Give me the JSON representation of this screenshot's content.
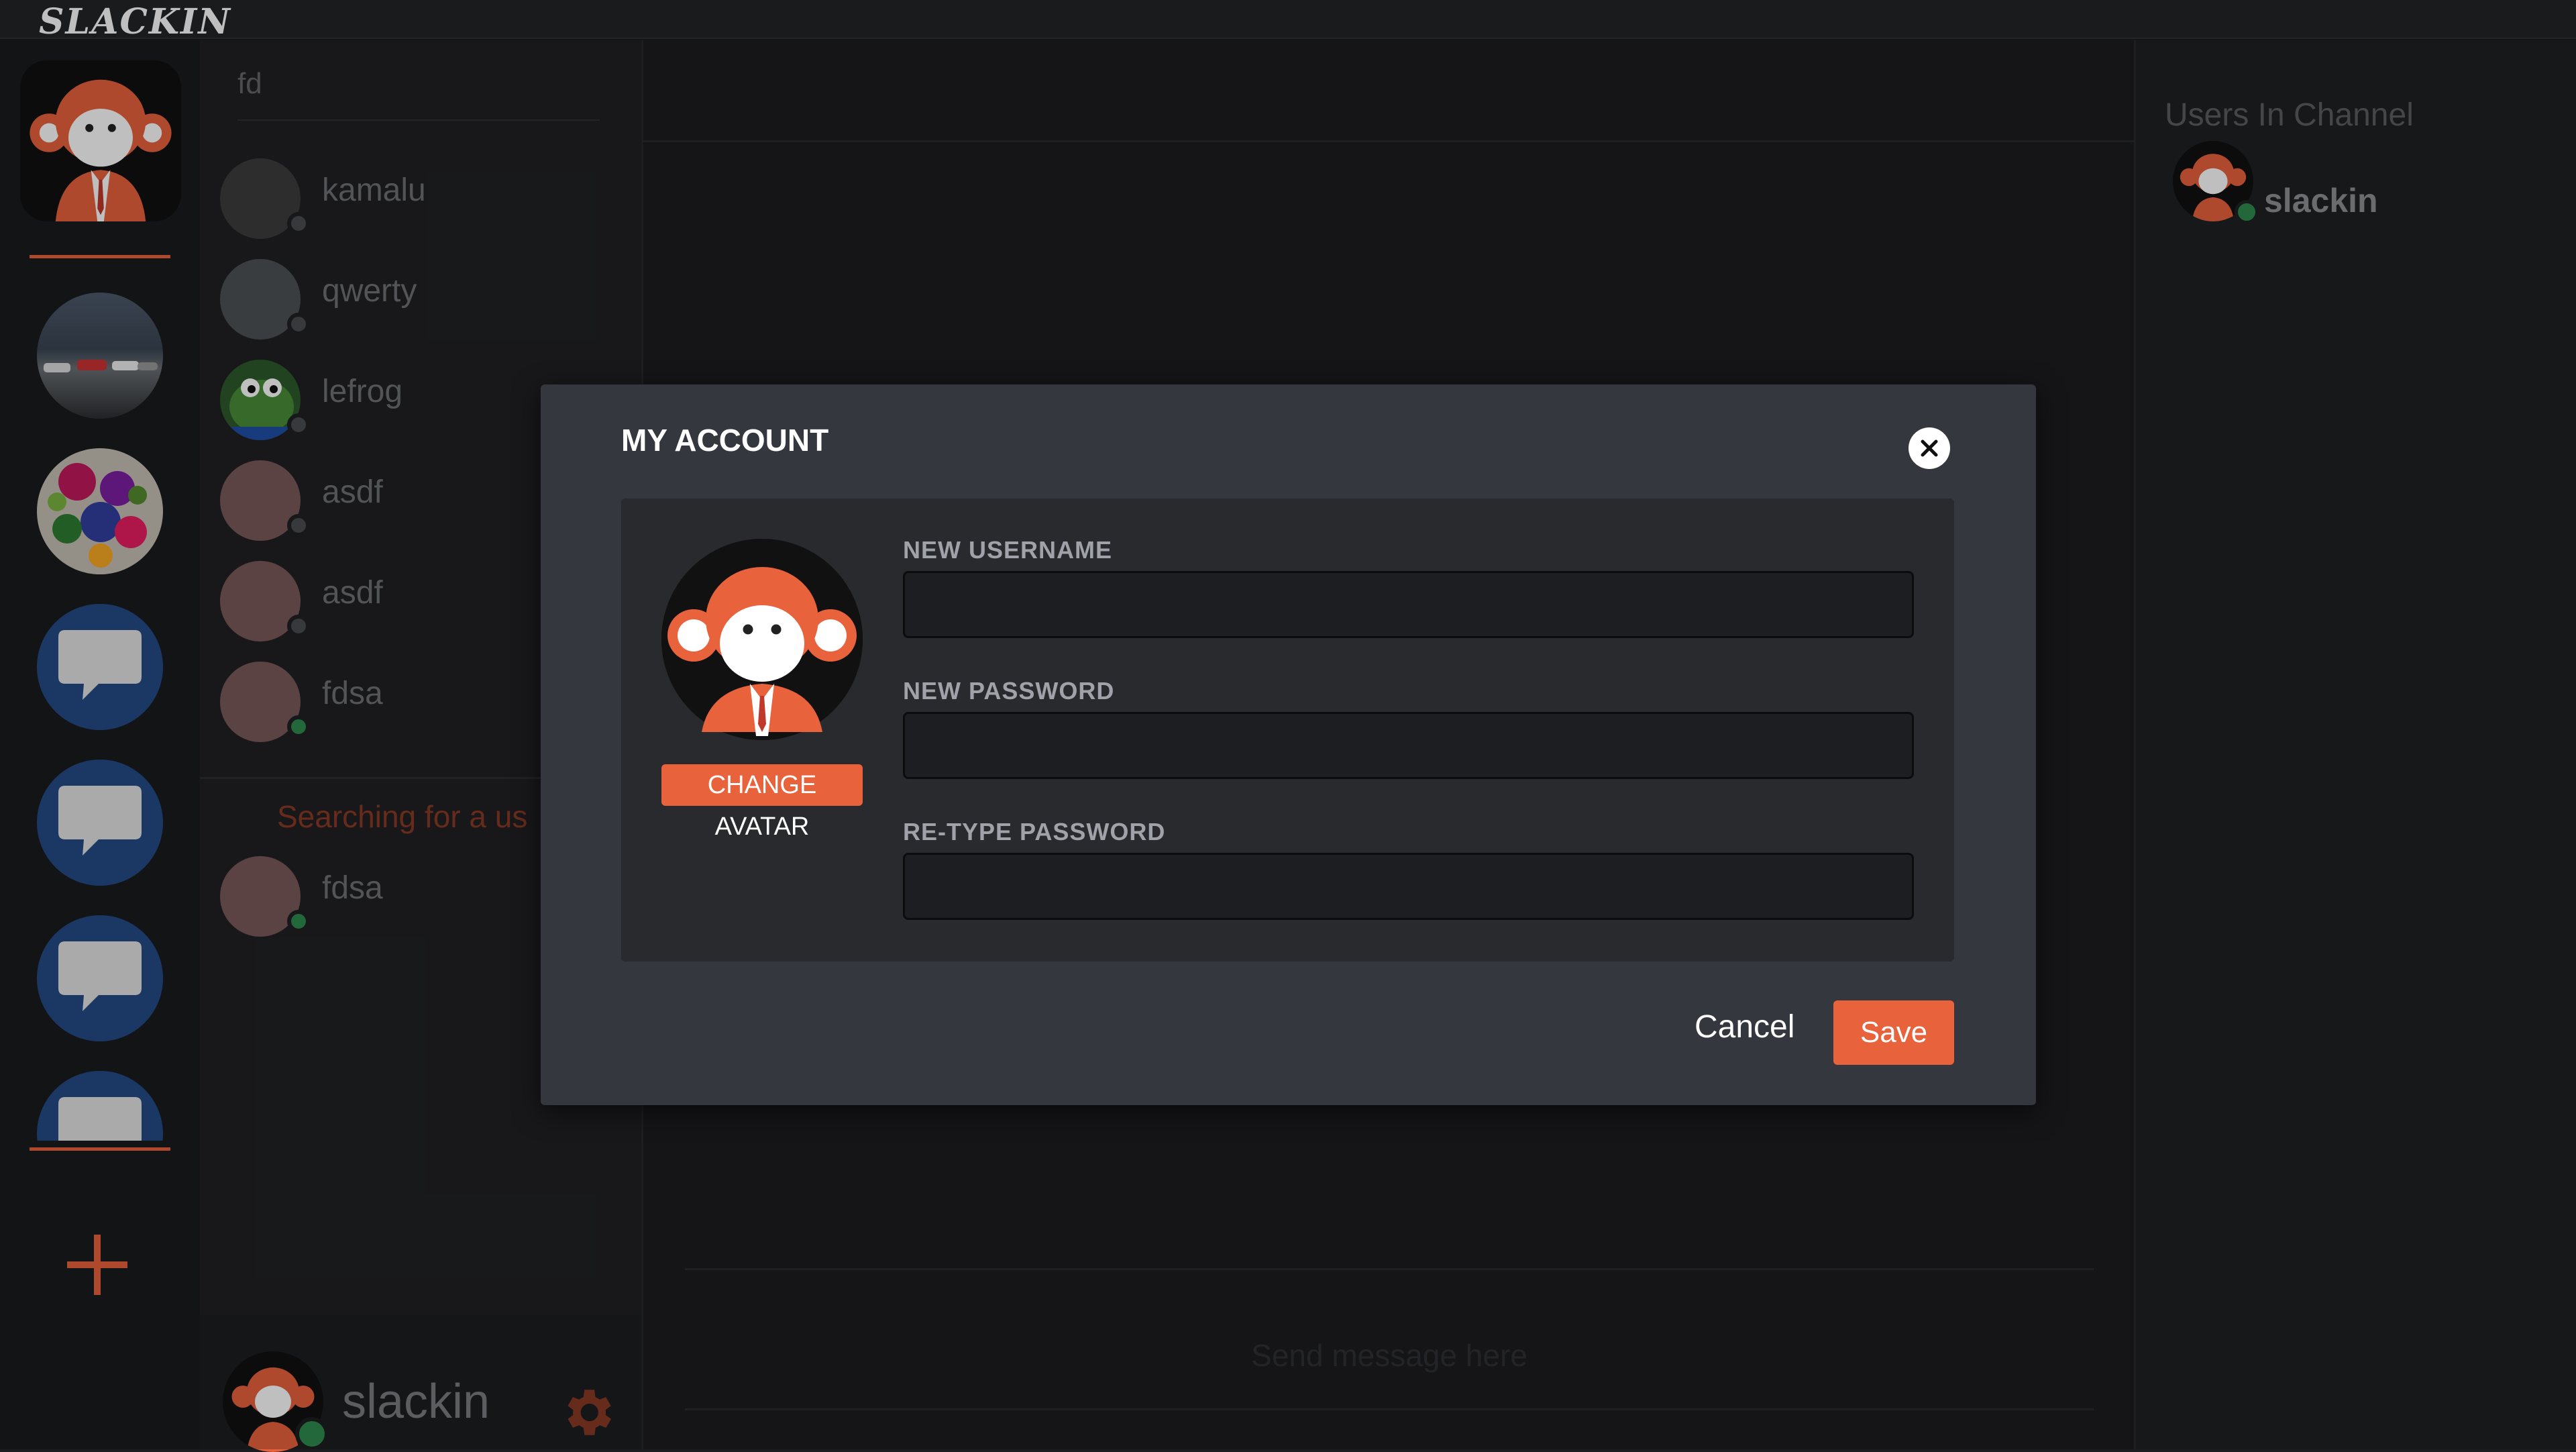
{
  "app": {
    "logo_text": "SLACKIN"
  },
  "dm_list": {
    "search_value": "fd",
    "items": [
      {
        "name": "kamalu",
        "status": "offline"
      },
      {
        "name": "qwerty",
        "status": "offline"
      },
      {
        "name": "lefrog",
        "status": "offline"
      },
      {
        "name": "asdf",
        "status": "offline"
      },
      {
        "name": "asdf",
        "status": "offline"
      },
      {
        "name": "fdsa",
        "status": "online"
      }
    ],
    "searching_text": "Searching for a us",
    "search_results": [
      {
        "name": "fdsa",
        "status": "online"
      }
    ]
  },
  "user_bar": {
    "username": "slackin",
    "settings_icon": "gear-icon"
  },
  "main": {
    "message_placeholder": "Send message here"
  },
  "right_panel": {
    "title": "Users In Channel",
    "users": [
      {
        "name": "slackin",
        "status": "online"
      }
    ]
  },
  "modal": {
    "title": "MY ACCOUNT",
    "change_avatar_label": "CHANGE AVATAR",
    "fields": [
      {
        "label": "NEW USERNAME",
        "value": ""
      },
      {
        "label": "NEW PASSWORD",
        "value": ""
      },
      {
        "label": "RE-TYPE PASSWORD",
        "value": ""
      }
    ],
    "cancel_label": "Cancel",
    "save_label": "Save"
  },
  "colors": {
    "accent": "#e8623c",
    "online": "#2e8b4e",
    "offline": "#4a4c50",
    "chat_bubble_bg": "#244a86"
  }
}
